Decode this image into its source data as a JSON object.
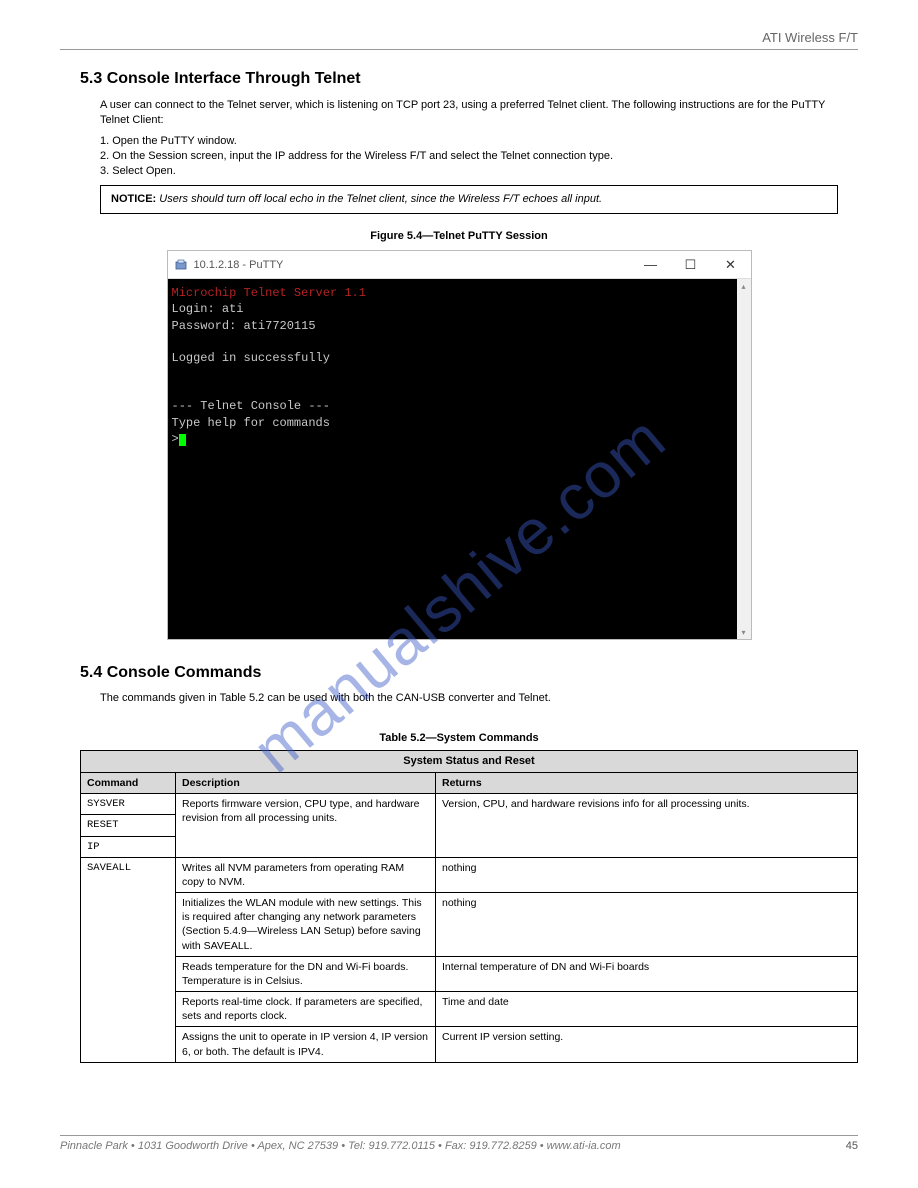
{
  "header": {
    "brand": "ATI Wireless F/T"
  },
  "sec": {
    "telnet_title": "5.3 Console Interface Through Telnet",
    "telnet_p1": "A user can connect to the Telnet server, which is listening on TCP port 23, using a preferred Telnet client. The following instructions are for the PuTTY Telnet Client:",
    "step1": "1.  Open the PuTTY window.",
    "step2": "2.  On the Session screen, input the IP address for the Wireless F/T and select the Telnet connection type.",
    "step3": "3.  Select Open.",
    "tip_label": "NOTICE:",
    "tip_text": " Users should turn off local echo in the Telnet client, since the Wireless F/T echoes all input.",
    "fig_label": "Figure 5.4—Telnet PuTTY Session",
    "cmds_title": "5.4 Console Commands",
    "cmds_intro": "The commands given in Table 5.2 can be used with both the CAN-USB converter and Telnet.",
    "tbl_label": "Table 5.2—System Commands"
  },
  "putty": {
    "title": "10.1.2.18 - PuTTY",
    "line_server": "Microchip Telnet Server 1.1",
    "line_login": "Login: ati",
    "line_pass": "Password: ati7720115",
    "line_ok": "Logged in successfully",
    "line_div": "--- Telnet Console ---",
    "line_help": "Type help for commands",
    "prompt": ">"
  },
  "table": {
    "hdr_main": "System Status and Reset",
    "h_cmd": "Command",
    "h_desc": "Description",
    "h_ret": "Returns",
    "rows_a": [
      {
        "cmd": "SYSVER",
        "desc_ml": "Reports firmware version, CPU type, and hardware revision from all processing units.",
        "ret_ml": "Version, CPU, and hardware revisions info for all processing units."
      },
      {
        "cmd": "RESET"
      },
      {
        "cmd": "IP"
      }
    ],
    "rows_b": [
      {
        "cmd": "SAVEALL",
        "desc": "Writes all NVM parameters from operating RAM copy to NVM.",
        "ret": "nothing"
      },
      {
        "cmd": "",
        "desc": "Initializes the WLAN module with new settings. This is required after changing any network parameters (Section 5.4.9—Wireless LAN Setup) before saving with SAVEALL.",
        "ret": "nothing"
      },
      {
        "cmd": "",
        "desc": "Reads temperature for the DN and Wi-Fi boards. Temperature is in Celsius.",
        "ret": "Internal temperature of DN and Wi-Fi boards"
      },
      {
        "cmd": "",
        "desc": "Reports real-time clock. If parameters are specified, sets and reports clock.",
        "ret": "Time and date"
      },
      {
        "cmd": "",
        "desc": "Assigns the unit to operate in IP version 4, IP version 6, or both. The default is IPV4.",
        "ret": "Current IP version setting."
      }
    ]
  },
  "footer": {
    "left": "Pinnacle Park • 1031 Goodworth Drive • Apex, NC 27539 • Tel: 919.772.0115 • Fax: 919.772.8259 • www.ati-ia.com",
    "page": "45"
  },
  "watermark": "manualshive.com"
}
